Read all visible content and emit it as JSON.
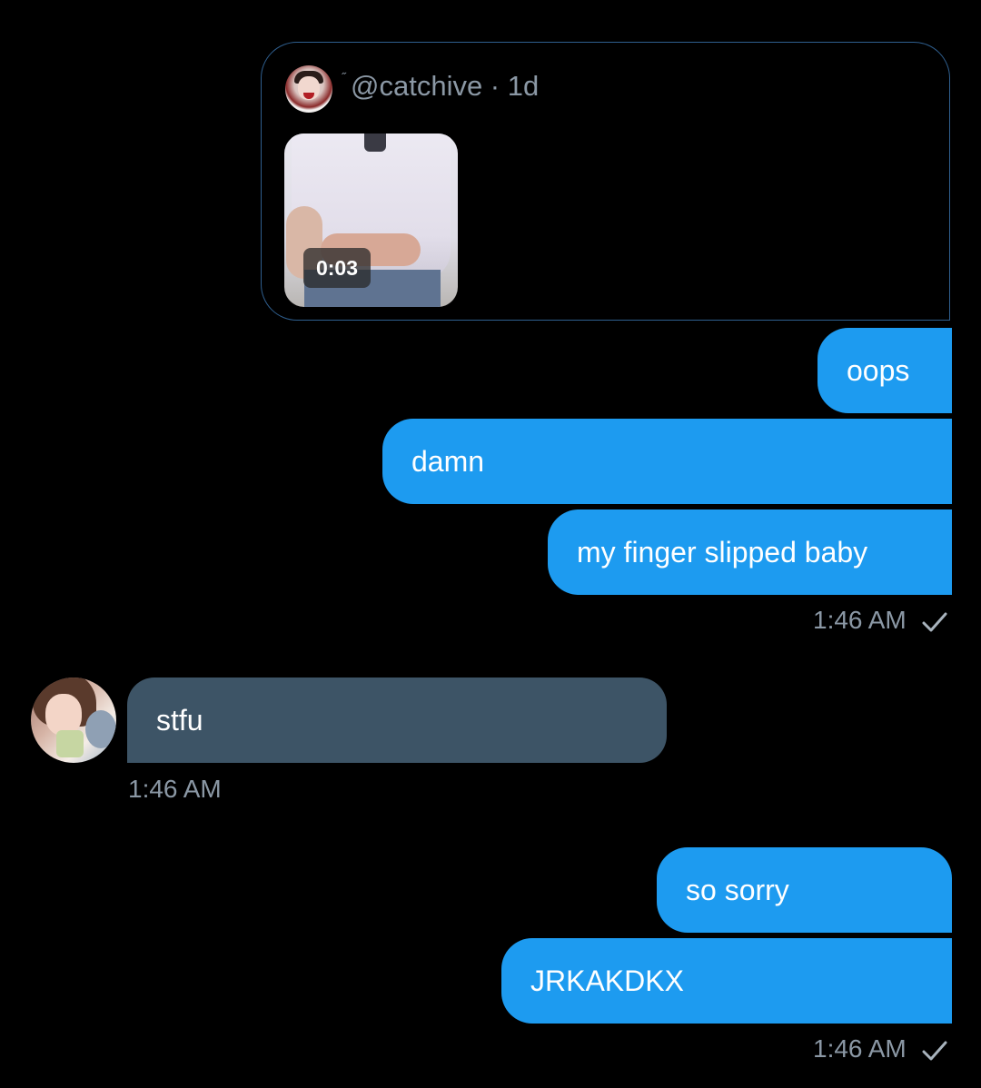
{
  "quoted_tweet": {
    "header": "@catchive · 1d",
    "header_mark": "˝",
    "video_duration": "0:03"
  },
  "messages": [
    {
      "text": "oops",
      "direction": "outgoing"
    },
    {
      "text": "damn",
      "direction": "outgoing"
    },
    {
      "text": "my finger slipped baby",
      "direction": "outgoing"
    },
    {
      "text": "stfu",
      "direction": "incoming"
    },
    {
      "text": "so sorry",
      "direction": "outgoing"
    },
    {
      "text": "JRKAKDKX",
      "direction": "outgoing"
    }
  ],
  "timestamps": {
    "group1": "1:46 AM",
    "incoming": "1:46 AM",
    "group2": "1:46 AM"
  },
  "colors": {
    "outgoing_bubble": "#1d9bf0",
    "incoming_bubble": "#3d5466",
    "background": "#000000",
    "muted_text": "#8b98a5"
  },
  "icons": {
    "sent": "check-icon",
    "media": "video-thumbnail"
  }
}
